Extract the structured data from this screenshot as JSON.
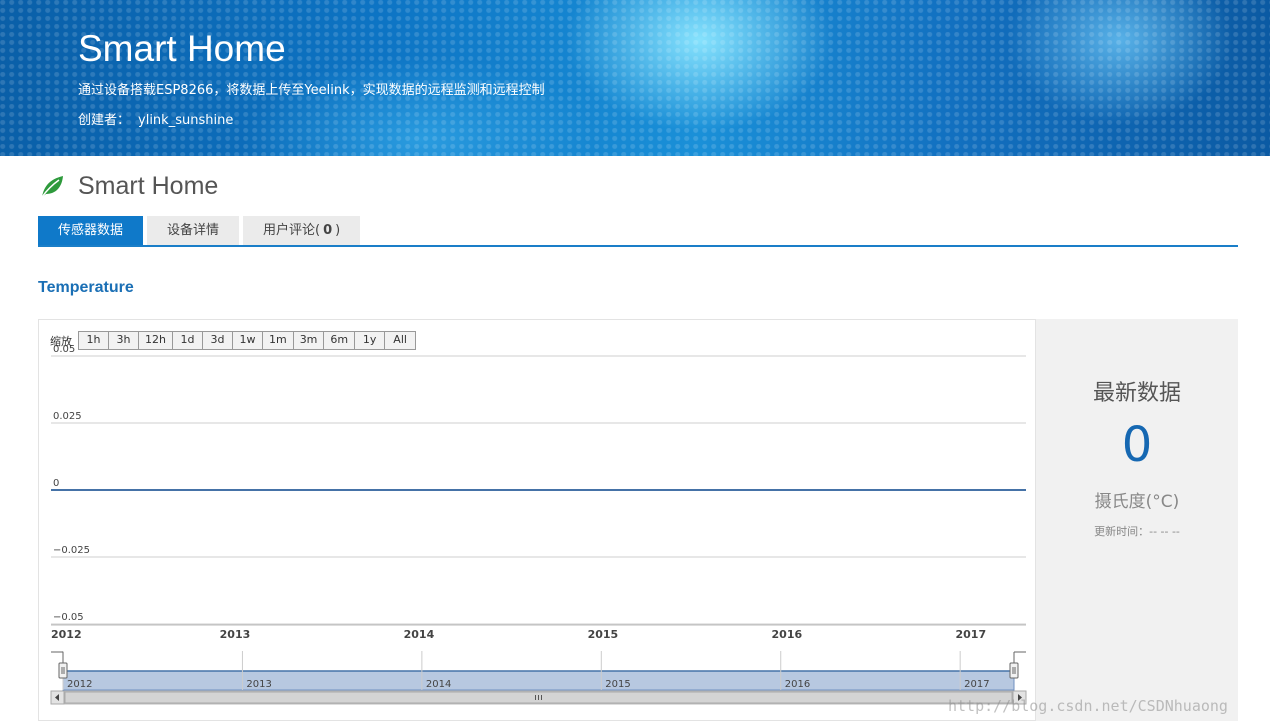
{
  "banner": {
    "title": "Smart Home",
    "description": "通过设备搭载ESP8266，将数据上传至Yeelink，实现数据的远程监测和远程控制",
    "creator_label": "创建者：",
    "creator_name": "ylink_sunshine"
  },
  "page": {
    "title": "Smart Home",
    "icon": "leaf-icon"
  },
  "tabs": [
    {
      "label": "传感器数据",
      "active": true
    },
    {
      "label": "设备详情",
      "active": false
    },
    {
      "label": "用户评论(",
      "count": "0",
      "suffix": ")",
      "active": false
    }
  ],
  "sensor": {
    "title": "Temperature"
  },
  "zoom": {
    "label": "缩放",
    "buttons": [
      "1h",
      "3h",
      "12h",
      "1d",
      "3d",
      "1w",
      "1m",
      "3m",
      "6m",
      "1y",
      "All"
    ]
  },
  "chart_data": {
    "type": "line",
    "title": "",
    "xlabel": "",
    "ylabel": "",
    "x": [
      2012,
      2017.3
    ],
    "series": [
      {
        "values": [
          0,
          0
        ]
      }
    ],
    "x_ticks": [
      "2012",
      "2013",
      "2014",
      "2015",
      "2016",
      "2017"
    ],
    "y_ticks": [
      "0.05",
      "0.025",
      "0",
      "−0.025",
      "−0.05"
    ],
    "y_tick_values": [
      0.05,
      0.025,
      0,
      -0.025,
      -0.05
    ],
    "xlim": [
      2012,
      2017.3
    ],
    "ylim": [
      -0.05,
      0.05
    ],
    "grid": true,
    "navigator_ticks": [
      "2012",
      "2013",
      "2014",
      "2015",
      "2016",
      "2017"
    ],
    "line_color": "#4572a7"
  },
  "latest": {
    "title": "最新数据",
    "value": "0",
    "unit": "摄氏度(°C)",
    "updated": "更新时间：-- -- --"
  },
  "watermark": "http://blog.csdn.net/CSDNhuaong",
  "colors": {
    "accent": "#0f79c9",
    "value": "#1668b2",
    "navigator_fill": "#b7c8e0"
  }
}
